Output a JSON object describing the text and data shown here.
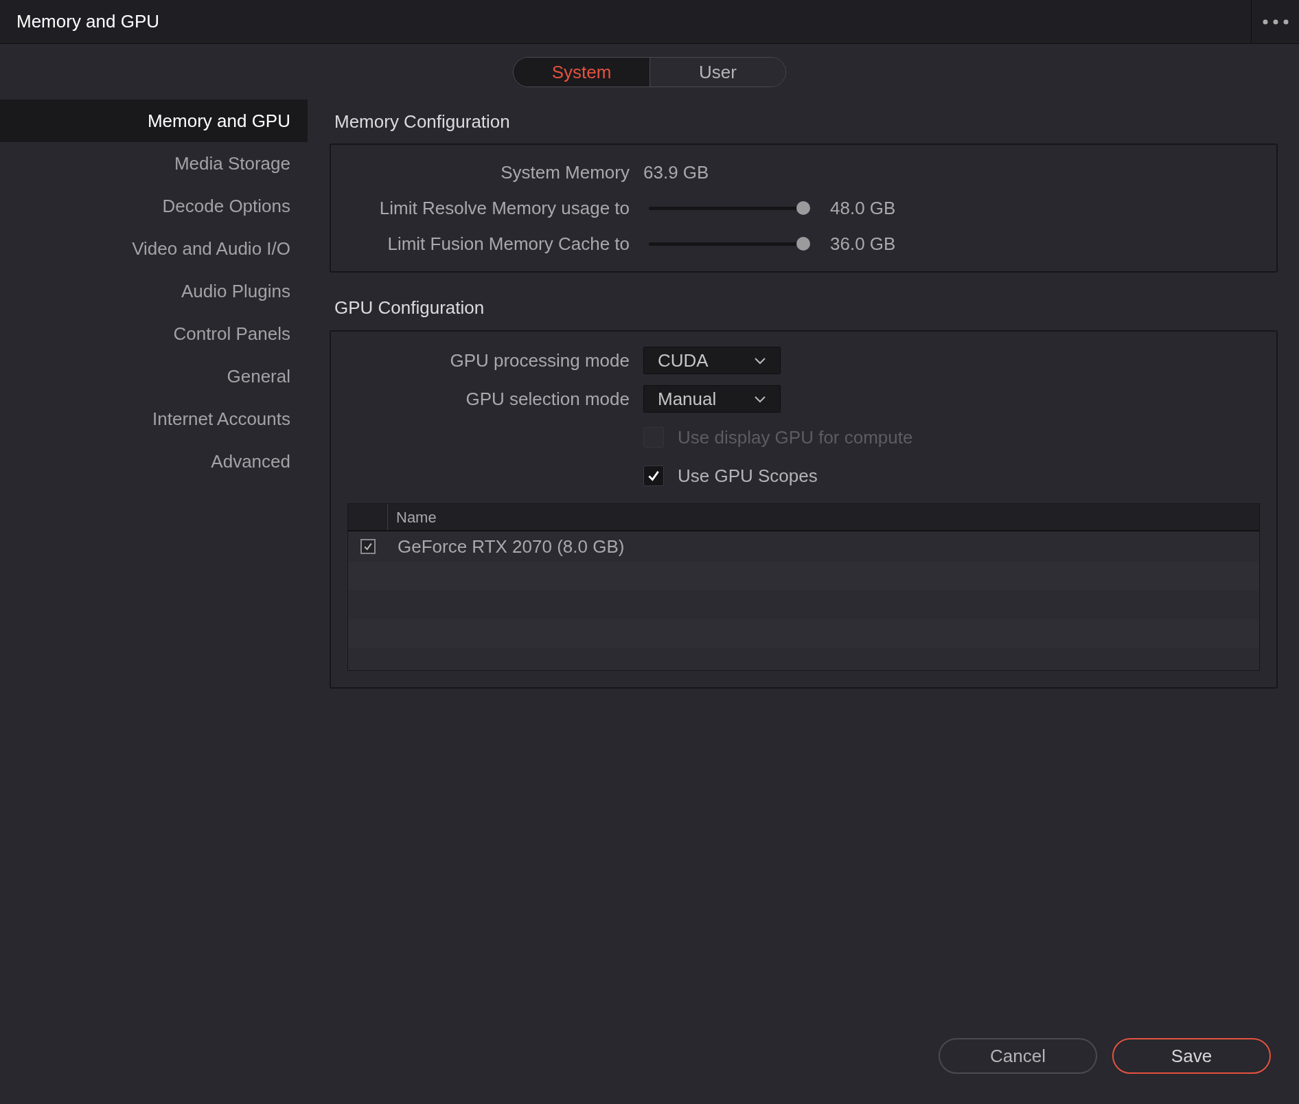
{
  "window": {
    "title": "Memory and GPU"
  },
  "tabs": [
    {
      "label": "System",
      "selected": true
    },
    {
      "label": "User",
      "selected": false
    }
  ],
  "sidebar": {
    "items": [
      {
        "label": "Memory and GPU",
        "selected": true
      },
      {
        "label": "Media Storage",
        "selected": false
      },
      {
        "label": "Decode Options",
        "selected": false
      },
      {
        "label": "Video and Audio I/O",
        "selected": false
      },
      {
        "label": "Audio Plugins",
        "selected": false
      },
      {
        "label": "Control Panels",
        "selected": false
      },
      {
        "label": "General",
        "selected": false
      },
      {
        "label": "Internet Accounts",
        "selected": false
      },
      {
        "label": "Advanced",
        "selected": false
      }
    ]
  },
  "memory_configuration": {
    "title": "Memory Configuration",
    "system_memory": {
      "label": "System Memory",
      "value": "63.9 GB"
    },
    "sliders": [
      {
        "label": "Limit Resolve Memory usage to",
        "level": 0.97,
        "reading": "48.0 GB"
      },
      {
        "label": "Limit Fusion Memory Cache to",
        "level": 0.97,
        "reading": "36.0 GB"
      }
    ]
  },
  "gpu_configuration": {
    "title": "GPU Configuration",
    "dropdowns": [
      {
        "label": "GPU processing mode",
        "value": "CUDA"
      },
      {
        "label": "GPU selection mode",
        "value": "Manual"
      }
    ],
    "checkboxes": [
      {
        "label": "Use display GPU for compute",
        "checked": false,
        "disabled": true
      },
      {
        "label": "Use GPU Scopes",
        "checked": true,
        "disabled": false
      }
    ],
    "table": {
      "columns": [
        "Name"
      ],
      "rows": [
        {
          "checked": true,
          "name": "GeForce RTX 2070 (8.0 GB)"
        }
      ]
    }
  },
  "buttons": [
    {
      "label": "Cancel",
      "kind": "secondary"
    },
    {
      "label": "Save",
      "kind": "primary"
    }
  ]
}
